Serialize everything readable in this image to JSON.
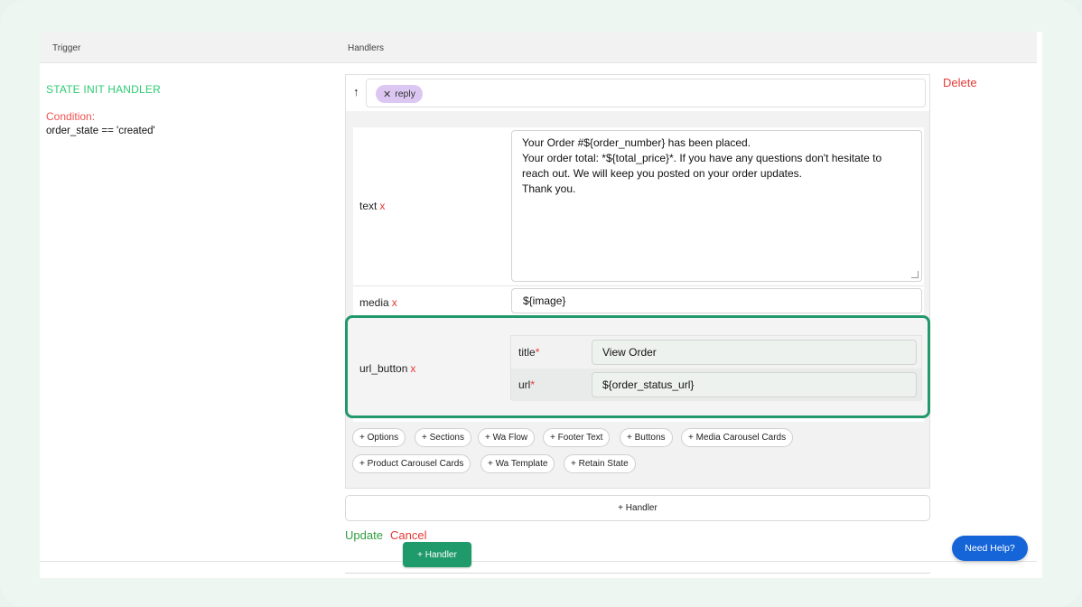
{
  "table": {
    "col_trigger": "Trigger",
    "col_handlers": "Handlers"
  },
  "trigger": {
    "title": "STATE INIT HANDLER",
    "condition_label": "Condition:",
    "condition_value": "order_state == 'created'"
  },
  "handler": {
    "delete_label": "Delete",
    "arrow_icon": "arrow-up-icon",
    "chip_label": "reply",
    "fields": {
      "text": {
        "label": "text",
        "remove": "x",
        "value": "Your Order #${order_number} has been placed.\nYour order total: *${total_price}*. If you have any questions don't hesitate to\nreach out. We will keep you posted on your order updates.\nThank you."
      },
      "media": {
        "label": "media",
        "remove": "x",
        "value": "${image}"
      },
      "url_button": {
        "label": "url_button",
        "remove": "x",
        "title_label": "title",
        "title_value": "View Order",
        "url_label": "url",
        "url_value": "${order_status_url}",
        "required_mark": "*"
      }
    },
    "add_options": [
      "+ Options",
      "+ Sections",
      "+ Wa Flow",
      "+ Footer Text",
      "+ Buttons",
      "+ Media Carousel Cards",
      "+ Product Carousel Cards",
      "+ Wa Template",
      "+ Retain State"
    ],
    "add_handler_label": "+ Handler"
  },
  "actions": {
    "update_label": "Update",
    "cancel_label": "Cancel",
    "add_handler_button": "+ Handler",
    "help_label": "Need Help?"
  },
  "colors": {
    "accent_green": "#23986b",
    "trigger_green": "#2ecc71",
    "danger_red": "#e53935",
    "help_blue": "#1565d8",
    "chip_purple": "#dcc7f2"
  }
}
